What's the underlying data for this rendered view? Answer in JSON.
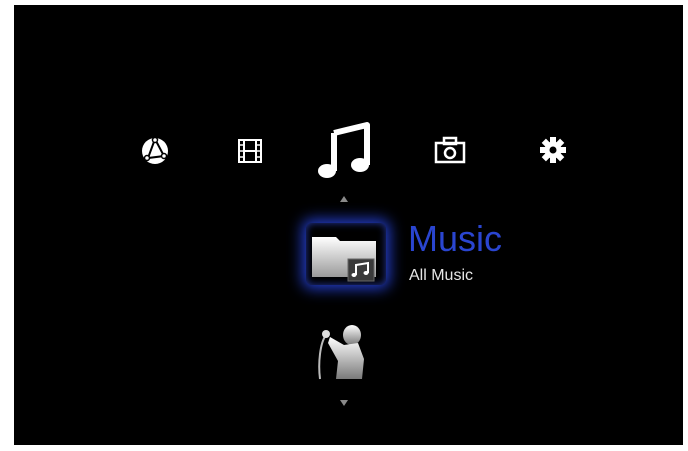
{
  "top_menu": {
    "items": [
      {
        "icon": "network-globe-icon",
        "selected": false
      },
      {
        "icon": "film-icon",
        "selected": false
      },
      {
        "icon": "music-note-icon",
        "selected": true
      },
      {
        "icon": "camera-icon",
        "selected": false
      },
      {
        "icon": "gear-icon",
        "selected": false
      }
    ]
  },
  "submenu": {
    "selected_item": {
      "icon": "music-folder-icon",
      "title": "Music",
      "subtitle": "All Music"
    },
    "next_item": {
      "icon": "singer-silhouette-icon"
    }
  },
  "colors": {
    "background": "#000000",
    "accent_blue": "#2a45d0",
    "text_white": "#e6e6e6"
  }
}
